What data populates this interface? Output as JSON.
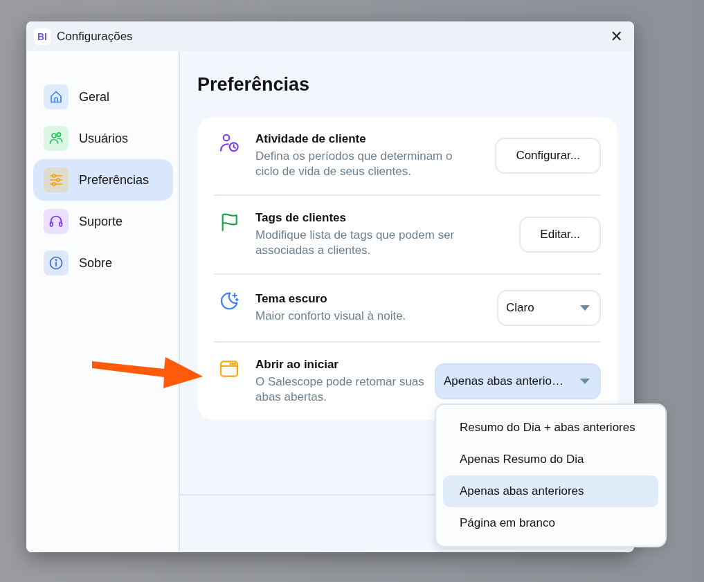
{
  "window": {
    "logo": "BI",
    "title": "Configurações",
    "close": "✕"
  },
  "sidebar": {
    "items": [
      {
        "label": "Geral",
        "selected": false,
        "color": "#3b82f6"
      },
      {
        "label": "Usuários",
        "selected": false,
        "color": "#22c55e"
      },
      {
        "label": "Preferências",
        "selected": true,
        "color": "#f59e0b"
      },
      {
        "label": "Suporte",
        "selected": false,
        "color": "#7c3aed"
      },
      {
        "label": "Sobre",
        "selected": false,
        "color": "#3a6fd1"
      }
    ]
  },
  "page": {
    "title": "Preferências"
  },
  "settings": [
    {
      "kind": "button",
      "title": "Atividade de cliente",
      "description": "Defina os períodos que determinam o ciclo de vida de seus clientes.",
      "color": "#7c3aed",
      "button": "Configurar..."
    },
    {
      "kind": "button",
      "title": "Tags de clientes",
      "description": "Modifique lista de tags que podem ser associadas a clientes.",
      "color": "#16a34a",
      "button": "Editar..."
    },
    {
      "kind": "dropdown",
      "title": "Tema escuro",
      "description": "Maior conforto visual à noite.",
      "color": "#3b82f6",
      "value": "Claro",
      "open": false
    },
    {
      "kind": "dropdown",
      "title": "Abrir ao iniciar",
      "description": "O Salescope pode retomar suas abas abertas.",
      "color": "#f5a70b",
      "value": "Apenas abas anterio…",
      "open": true,
      "options": [
        {
          "label": "Resumo do Dia + abas anteriores",
          "selected": false
        },
        {
          "label": "Apenas Resumo do Dia",
          "selected": false
        },
        {
          "label": "Apenas abas anteriores",
          "selected": true
        },
        {
          "label": "Página em branco",
          "selected": false
        }
      ]
    }
  ]
}
